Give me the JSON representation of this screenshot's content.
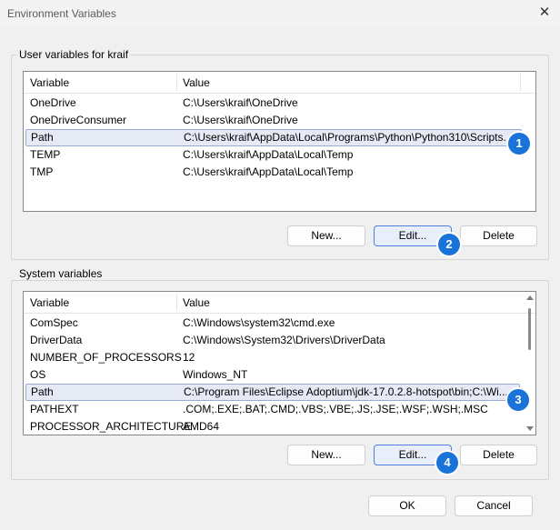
{
  "window": {
    "title": "Environment Variables",
    "close_glyph": "✕"
  },
  "user_group": {
    "label": "User variables for kraif",
    "columns": [
      "Variable",
      "Value"
    ],
    "rows": [
      {
        "variable": "OneDrive",
        "value": "C:\\Users\\kraif\\OneDrive"
      },
      {
        "variable": "OneDriveConsumer",
        "value": "C:\\Users\\kraif\\OneDrive"
      },
      {
        "variable": "Path",
        "value": "C:\\Users\\kraif\\AppData\\Local\\Programs\\Python\\Python310\\Scripts..."
      },
      {
        "variable": "TEMP",
        "value": "C:\\Users\\kraif\\AppData\\Local\\Temp"
      },
      {
        "variable": "TMP",
        "value": "C:\\Users\\kraif\\AppData\\Local\\Temp"
      }
    ],
    "selected_row": 2,
    "buttons": {
      "new": "New...",
      "edit": "Edit...",
      "delete": "Delete"
    }
  },
  "system_group": {
    "label": "System variables",
    "columns": [
      "Variable",
      "Value"
    ],
    "rows": [
      {
        "variable": "ComSpec",
        "value": "C:\\Windows\\system32\\cmd.exe"
      },
      {
        "variable": "DriverData",
        "value": "C:\\Windows\\System32\\Drivers\\DriverData"
      },
      {
        "variable": "NUMBER_OF_PROCESSORS",
        "value": "12"
      },
      {
        "variable": "OS",
        "value": "Windows_NT"
      },
      {
        "variable": "Path",
        "value": "C:\\Program Files\\Eclipse Adoptium\\jdk-17.0.2.8-hotspot\\bin;C:\\Wi..."
      },
      {
        "variable": "PATHEXT",
        "value": ".COM;.EXE;.BAT;.CMD;.VBS;.VBE;.JS;.JSE;.WSF;.WSH;.MSC"
      },
      {
        "variable": "PROCESSOR_ARCHITECTURE",
        "value": "AMD64"
      }
    ],
    "selected_row": 4,
    "buttons": {
      "new": "New...",
      "edit": "Edit...",
      "delete": "Delete"
    }
  },
  "footer": {
    "ok": "OK",
    "cancel": "Cancel"
  },
  "callouts": [
    "1",
    "2",
    "3",
    "4"
  ],
  "colors": {
    "accent": "#1a73d8",
    "selection": "#e5eaf4",
    "focus_border": "#4d7ee0"
  }
}
